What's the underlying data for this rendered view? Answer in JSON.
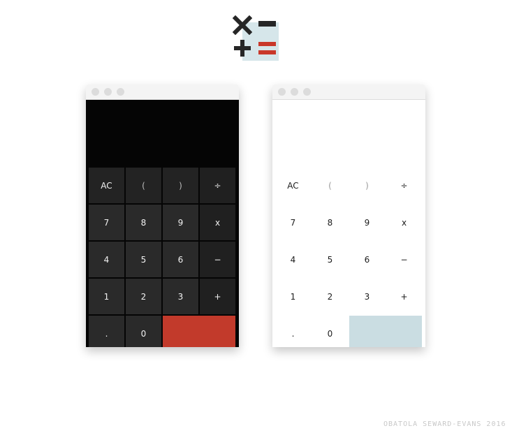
{
  "logo": {
    "icons": [
      "times-icon",
      "minus-icon",
      "plus-icon",
      "equals-icon"
    ],
    "colors": {
      "dark": "#262626",
      "accent": "#c9382a",
      "tint": "#d6e6ea"
    }
  },
  "windows": {
    "dark": {
      "theme_colors": {
        "background": "#050505",
        "key": "#2a2a2a",
        "equals": "#c23a2b"
      },
      "display_value": ""
    },
    "light": {
      "theme_colors": {
        "background": "#ffffff",
        "key": "#ffffff",
        "equals": "#cadde2"
      },
      "display_value": ""
    }
  },
  "keys": {
    "ac": "AC",
    "open_paren": "(",
    "close_paren": ")",
    "divide": "÷",
    "seven": "7",
    "eight": "8",
    "nine": "9",
    "multiply": "x",
    "four": "4",
    "five": "5",
    "six": "6",
    "minus": "−",
    "one": "1",
    "two": "2",
    "three": "3",
    "plus": "+",
    "decimal": ".",
    "zero": "0",
    "equals": ""
  },
  "credit": "OBATOLA SEWARD-EVANS 2016"
}
